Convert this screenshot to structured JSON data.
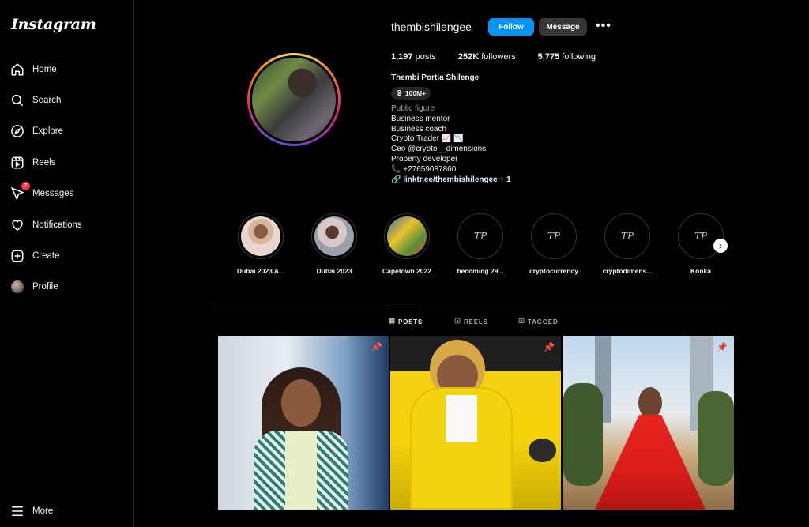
{
  "sidebar": {
    "logo": "Instagram",
    "items": [
      {
        "label": "Home",
        "icon": "home-icon"
      },
      {
        "label": "Search",
        "icon": "search-icon"
      },
      {
        "label": "Explore",
        "icon": "compass-icon"
      },
      {
        "label": "Reels",
        "icon": "reels-icon"
      },
      {
        "label": "Messages",
        "icon": "messenger-icon",
        "badge": "7"
      },
      {
        "label": "Notifications",
        "icon": "heart-icon"
      },
      {
        "label": "Create",
        "icon": "plus-square-icon"
      },
      {
        "label": "Profile",
        "icon": "avatar"
      }
    ],
    "more_label": "More"
  },
  "profile": {
    "username": "thembishilengee",
    "follow_label": "Follow",
    "message_label": "Message",
    "stats": {
      "posts": "1,197",
      "posts_label": "posts",
      "followers": "252K",
      "followers_label": "followers",
      "following": "5,775",
      "following_label": "following"
    },
    "full_name": "Thembi Portia Shilenge",
    "threads_badge": "100M+",
    "bio": {
      "category": "Public figure",
      "lines": [
        "Business mentor",
        "Business coach",
        "Crypto Trader 📈 📉",
        "Ceo @crypto__dimensions",
        "Property developer"
      ],
      "phone": "+27659087860",
      "link": "linktr.ee/thembishilengee",
      "link_extra": "+ 1"
    }
  },
  "highlights": [
    {
      "label": "Dubai 2023 A..."
    },
    {
      "label": "Dubai 2023"
    },
    {
      "label": "Capetown 2022"
    },
    {
      "label": "becoming 29..."
    },
    {
      "label": "cryptocurrency"
    },
    {
      "label": "cryptodimens..."
    },
    {
      "label": "Konka"
    }
  ],
  "tabs": [
    {
      "label": "POSTS",
      "active": true
    },
    {
      "label": "REELS",
      "active": false
    },
    {
      "label": "TAGGED",
      "active": false
    }
  ],
  "colors": {
    "accent": "#0095f6",
    "badge": "#ff3040",
    "background": "#000000"
  }
}
